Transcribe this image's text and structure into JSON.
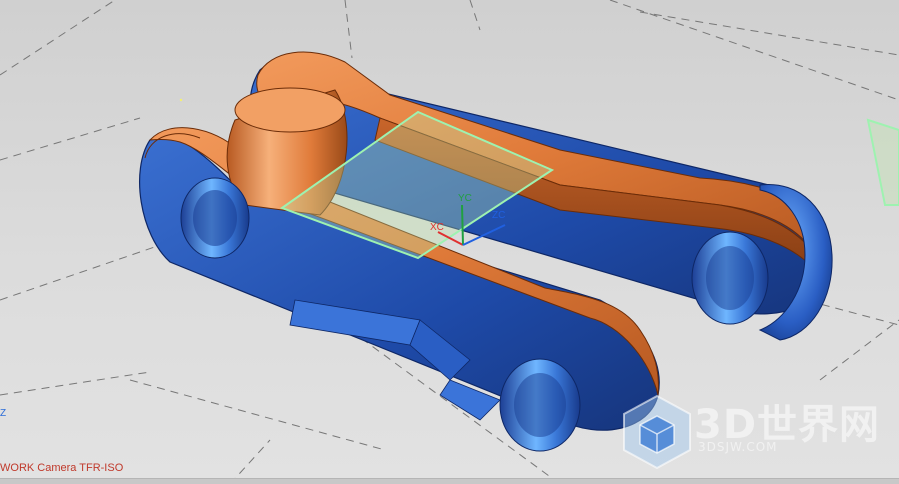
{
  "viewport": {
    "background_color": "#d9d9d9",
    "grid_line_color": "#777777"
  },
  "model": {
    "top_face_color": "#e07b3a",
    "side_face_color": "#2a55b0",
    "bore_color": "#3a78d8",
    "sketch_plane_color": "#9ef2b0"
  },
  "wcs_triad": {
    "xc_label": "XC",
    "yc_label": "YC",
    "zc_label": "ZC",
    "xc_color": "#e03030",
    "yc_color": "#20a040",
    "zc_color": "#2060e0"
  },
  "status": {
    "camera_text": "WORK Camera TFR-ISO",
    "edge_axis_text": "Z"
  },
  "watermark": {
    "brand_text": "3D世界网",
    "url_text": "3DSJW.COM",
    "icon": "cube-logo-icon"
  }
}
